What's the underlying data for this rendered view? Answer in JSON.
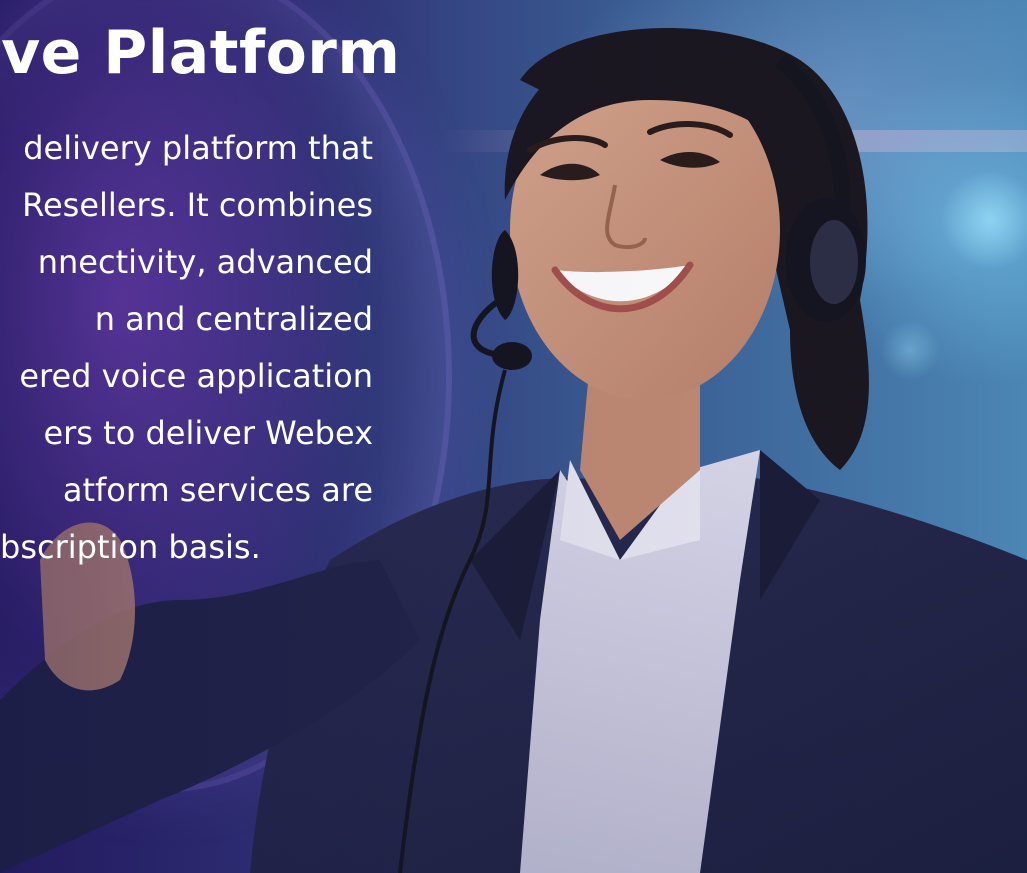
{
  "hero": {
    "heading": "ive Platform",
    "paragraph_lines": [
      "delivery platform that",
      "Resellers. It combines",
      "nnectivity, advanced",
      "n and centralized",
      "ered voice application",
      "ers to deliver Webex",
      "atform services are",
      "bscription basis."
    ]
  },
  "colors": {
    "text": "#ffffff",
    "background_left": "#2b1f6e",
    "background_right": "#4b86b4",
    "accent_glow": "#8a6ef0"
  },
  "image": {
    "subject": "smiling-woman-with-headset"
  }
}
